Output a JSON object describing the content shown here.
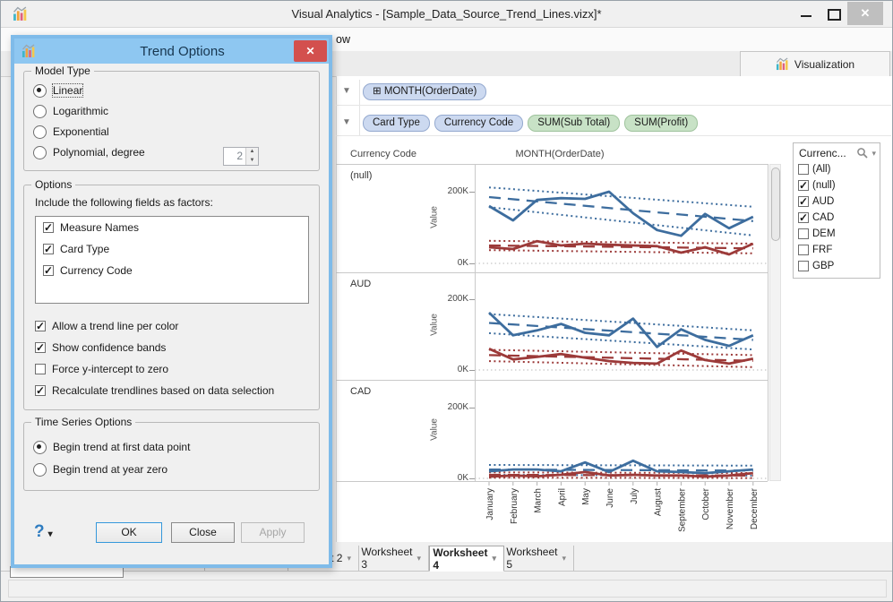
{
  "window": {
    "title": "Visual Analytics - [Sample_Data_Source_Trend_Lines.vizx]*"
  },
  "menu": {
    "fragment": "ow"
  },
  "viz_tab": {
    "label": "Visualization"
  },
  "shelves": {
    "columns_prefix": "⊞",
    "columns_label": "MONTH(OrderDate)",
    "rows": [
      {
        "label": "Card Type",
        "kind": "dim"
      },
      {
        "label": "Currency Code",
        "kind": "dim"
      },
      {
        "label": "SUM(Sub Total)",
        "kind": "measure"
      },
      {
        "label": "SUM(Profit)",
        "kind": "measure"
      }
    ]
  },
  "filter": {
    "title": "Currenc...",
    "items": [
      {
        "label": "(All)",
        "checked": false
      },
      {
        "label": "(null)",
        "checked": true
      },
      {
        "label": "AUD",
        "checked": true
      },
      {
        "label": "CAD",
        "checked": true
      },
      {
        "label": "DEM",
        "checked": false
      },
      {
        "label": "FRF",
        "checked": false
      },
      {
        "label": "GBP",
        "checked": false
      }
    ]
  },
  "sheet_tabs": {
    "items": [
      {
        "label": "t 2",
        "active": false
      },
      {
        "label": "Worksheet 3",
        "active": false
      },
      {
        "label": "Worksheet 4",
        "active": true
      },
      {
        "label": "Worksheet 5",
        "active": false
      }
    ]
  },
  "dialog": {
    "title": "Trend Options",
    "model_type": {
      "legend": "Model Type",
      "spinner_value": "2",
      "options": [
        {
          "label": "Linear",
          "selected": true
        },
        {
          "label": "Logarithmic",
          "selected": false
        },
        {
          "label": "Exponential",
          "selected": false
        },
        {
          "label": "Polynomial, degree",
          "selected": false,
          "has_spinner": true
        }
      ]
    },
    "options": {
      "legend": "Options",
      "factors_label": "Include the following fields as factors:",
      "factors": [
        {
          "label": "Measure Names",
          "checked": true
        },
        {
          "label": "Card Type",
          "checked": true
        },
        {
          "label": "Currency Code",
          "checked": true
        }
      ],
      "checks": [
        {
          "label": "Allow a trend line per color",
          "checked": true
        },
        {
          "label": "Show confidence bands",
          "checked": true
        },
        {
          "label": "Force y-intercept to zero",
          "checked": false
        },
        {
          "label": "Recalculate trendlines based on data selection",
          "checked": true
        }
      ]
    },
    "time_series": {
      "legend": "Time Series Options",
      "options": [
        {
          "label": "Begin trend at first data point",
          "selected": true
        },
        {
          "label": "Begin trend at year zero",
          "selected": false
        }
      ]
    },
    "buttons": {
      "help": "?",
      "ok": "OK",
      "close": "Close",
      "apply": "Apply"
    }
  },
  "chart_data": {
    "type": "line",
    "row_header": "Currency Code",
    "col_header": "MONTH(OrderDate)",
    "ylabel": "Value",
    "ylim": [
      0,
      250
    ],
    "yticks": [
      {
        "label": "200K",
        "v": 200
      },
      {
        "label": "0K",
        "v": 0
      }
    ],
    "x": [
      "January",
      "February",
      "March",
      "April",
      "May",
      "June",
      "July",
      "August",
      "September",
      "October",
      "November",
      "December"
    ],
    "colors": {
      "blue": "#3d6d9e",
      "red": "#9c3a39"
    },
    "units": "K",
    "panels": [
      {
        "label": "(null)",
        "series": [
          {
            "name": "confidence band upper",
            "color": "blue",
            "style": "dotted",
            "trend": [
              212,
              158
            ]
          },
          {
            "name": "confidence band lower",
            "color": "blue",
            "style": "dotted",
            "trend": [
              157,
              78
            ]
          },
          {
            "name": "trend line",
            "color": "blue",
            "style": "dashed",
            "trend": [
              185,
              118
            ]
          },
          {
            "name": "confidence band upper",
            "color": "red",
            "style": "dotted",
            "trend": [
              63,
              55
            ]
          },
          {
            "name": "confidence band lower",
            "color": "red",
            "style": "dotted",
            "trend": [
              37,
              28
            ]
          },
          {
            "name": "trend line",
            "color": "red",
            "style": "dashed",
            "trend": [
              50,
              42
            ]
          },
          {
            "name": "SUM(Sub Total)",
            "color": "blue",
            "style": "solid",
            "values": [
              160,
              120,
              177,
              182,
              180,
              200,
              140,
              93,
              77,
              138,
              98,
              130
            ]
          },
          {
            "name": "SUM(Profit)",
            "color": "red",
            "style": "solid",
            "values": [
              45,
              40,
              62,
              50,
              55,
              52,
              50,
              48,
              30,
              45,
              25,
              55
            ]
          }
        ]
      },
      {
        "label": "AUD",
        "series": [
          {
            "name": "confidence band upper",
            "color": "blue",
            "style": "dotted",
            "trend": [
              158,
              112
            ]
          },
          {
            "name": "confidence band lower",
            "color": "blue",
            "style": "dotted",
            "trend": [
              104,
              58
            ]
          },
          {
            "name": "trend line",
            "color": "blue",
            "style": "dashed",
            "trend": [
              133,
              85
            ]
          },
          {
            "name": "confidence band upper",
            "color": "red",
            "style": "dotted",
            "trend": [
              57,
              42
            ]
          },
          {
            "name": "confidence band lower",
            "color": "red",
            "style": "dotted",
            "trend": [
              25,
              8
            ]
          },
          {
            "name": "trend line",
            "color": "red",
            "style": "dashed",
            "trend": [
              42,
              26
            ]
          },
          {
            "name": "SUM(Sub Total)",
            "color": "blue",
            "style": "solid",
            "values": [
              162,
              98,
              112,
              130,
              105,
              98,
              145,
              65,
              115,
              85,
              68,
              98
            ]
          },
          {
            "name": "SUM(Profit)",
            "color": "red",
            "style": "solid",
            "values": [
              60,
              30,
              37,
              45,
              35,
              25,
              20,
              18,
              55,
              28,
              18,
              32
            ]
          }
        ]
      },
      {
        "label": "CAD",
        "series": [
          {
            "name": "confidence band upper",
            "color": "blue",
            "style": "dotted",
            "trend": [
              38,
              36
            ]
          },
          {
            "name": "confidence band lower",
            "color": "blue",
            "style": "dotted",
            "trend": [
              10,
              8
            ]
          },
          {
            "name": "trend line",
            "color": "blue",
            "style": "dashed",
            "trend": [
              25,
              22
            ]
          },
          {
            "name": "confidence band upper",
            "color": "red",
            "style": "dotted",
            "trend": [
              17,
              15
            ]
          },
          {
            "name": "confidence band lower",
            "color": "red",
            "style": "dotted",
            "trend": [
              2,
              1
            ]
          },
          {
            "name": "trend line",
            "color": "red",
            "style": "dashed",
            "trend": [
              10,
              8
            ]
          },
          {
            "name": "SUM(Sub Total)",
            "color": "blue",
            "style": "solid",
            "values": [
              20,
              25,
              25,
              20,
              45,
              18,
              50,
              20,
              18,
              15,
              20,
              25
            ]
          },
          {
            "name": "SUM(Profit)",
            "color": "red",
            "style": "solid",
            "values": [
              5,
              8,
              6,
              10,
              18,
              8,
              10,
              8,
              8,
              5,
              8,
              15
            ]
          }
        ]
      }
    ]
  }
}
